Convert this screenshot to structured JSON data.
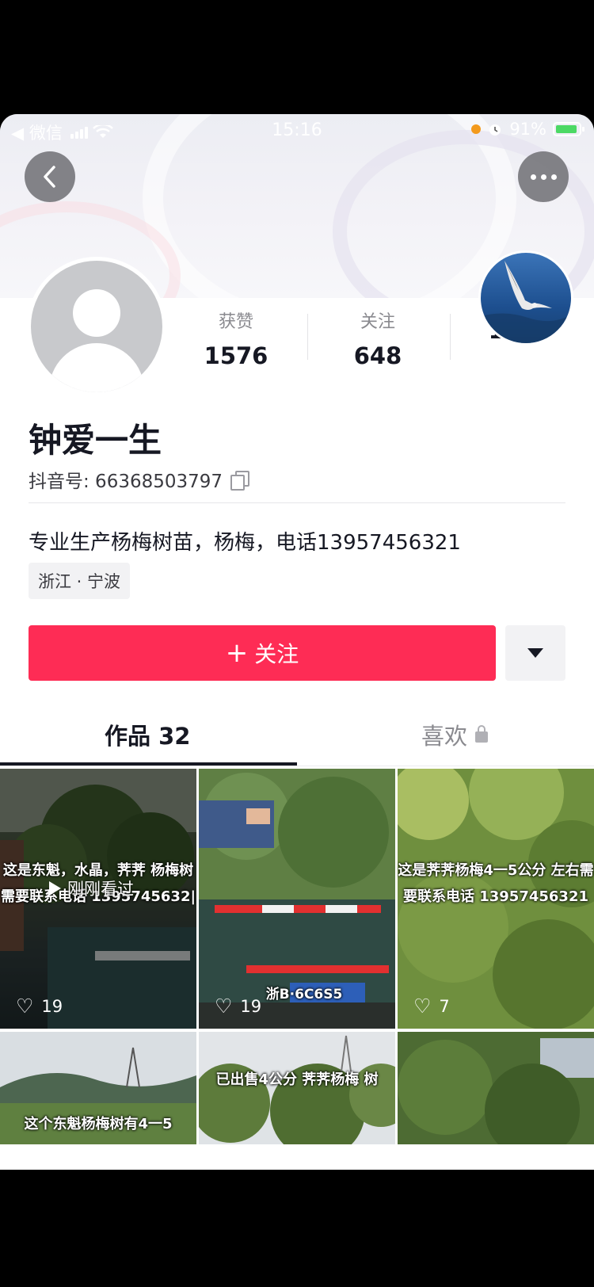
{
  "status_bar": {
    "carrier": "◀ 微信",
    "time": "15:16",
    "battery": "91%"
  },
  "profile": {
    "name": "钟爱一生",
    "douyin_id_label": "抖音号: 66368503797",
    "bio": "专业生产杨梅树苗，杨梅，电话13957456321",
    "location": "浙江 · 宁波",
    "stats": [
      {
        "label": "获赞",
        "value": "1576"
      },
      {
        "label": "关注",
        "value": "648"
      },
      {
        "label": "",
        "value": "1014"
      }
    ]
  },
  "actions": {
    "follow_label": "关注",
    "follow_plus": "+"
  },
  "tabs": {
    "works": "作品 32",
    "likes": "喜欢"
  },
  "videos": [
    {
      "caption": "这是东魁，水晶，荠荠 杨梅树需要联系电话 1395745632|",
      "likes": "19",
      "badge": "刚刚看过"
    },
    {
      "caption": "",
      "likes": "19",
      "plate": "浙B·6C6S5"
    },
    {
      "caption": "这是荠荠杨梅4一5公分 左右需要联系电话 13957456321",
      "likes": "7"
    },
    {
      "caption": "这个东魁杨梅树有4一5",
      "likes": ""
    },
    {
      "caption": "已出售4公分 荠荠杨梅 树",
      "likes": ""
    },
    {
      "caption": "",
      "likes": ""
    }
  ],
  "colors": {
    "accent": "#fe2c55",
    "text": "#161823"
  }
}
